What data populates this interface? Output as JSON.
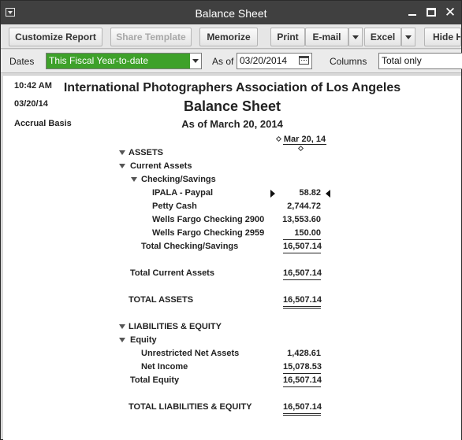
{
  "window": {
    "title": "Balance Sheet"
  },
  "toolbar": {
    "customize": "Customize Report",
    "share": "Share Template",
    "memorize": "Memorize",
    "print": "Print",
    "email": "E-mail",
    "excel": "Excel",
    "hide": "Hide H"
  },
  "filters": {
    "dates_label": "Dates",
    "dates_value": "This Fiscal Year-to-date",
    "asof_label": "As of",
    "asof_value": "03/20/2014",
    "columns_label": "Columns",
    "columns_value": "Total only"
  },
  "report": {
    "time": "10:42 AM",
    "date": "03/20/14",
    "basis": "Accrual Basis",
    "company": "International Photographers Association of Los Angeles",
    "title": "Balance Sheet",
    "as_of": "As of March 20, 2014",
    "column_header": "Mar 20, 14",
    "rows": [
      {
        "label": "ASSETS",
        "amount": ""
      },
      {
        "label": "Current Assets",
        "amount": ""
      },
      {
        "label": "Checking/Savings",
        "amount": ""
      },
      {
        "label": "IPALA - Paypal",
        "amount": "58.82"
      },
      {
        "label": "Petty Cash",
        "amount": "2,744.72"
      },
      {
        "label": "Wells Fargo Checking 2900",
        "amount": "13,553.60"
      },
      {
        "label": "Wells Fargo Checking 2959",
        "amount": "150.00"
      },
      {
        "label": "Total Checking/Savings",
        "amount": "16,507.14"
      },
      {
        "label": "Total Current Assets",
        "amount": "16,507.14"
      },
      {
        "label": "TOTAL ASSETS",
        "amount": "16,507.14"
      },
      {
        "label": "LIABILITIES & EQUITY",
        "amount": ""
      },
      {
        "label": "Equity",
        "amount": ""
      },
      {
        "label": "Unrestricted Net Assets",
        "amount": "1,428.61"
      },
      {
        "label": "Net Income",
        "amount": "15,078.53"
      },
      {
        "label": "Total Equity",
        "amount": "16,507.14"
      },
      {
        "label": "TOTAL LIABILITIES & EQUITY",
        "amount": "16,507.14"
      }
    ]
  }
}
